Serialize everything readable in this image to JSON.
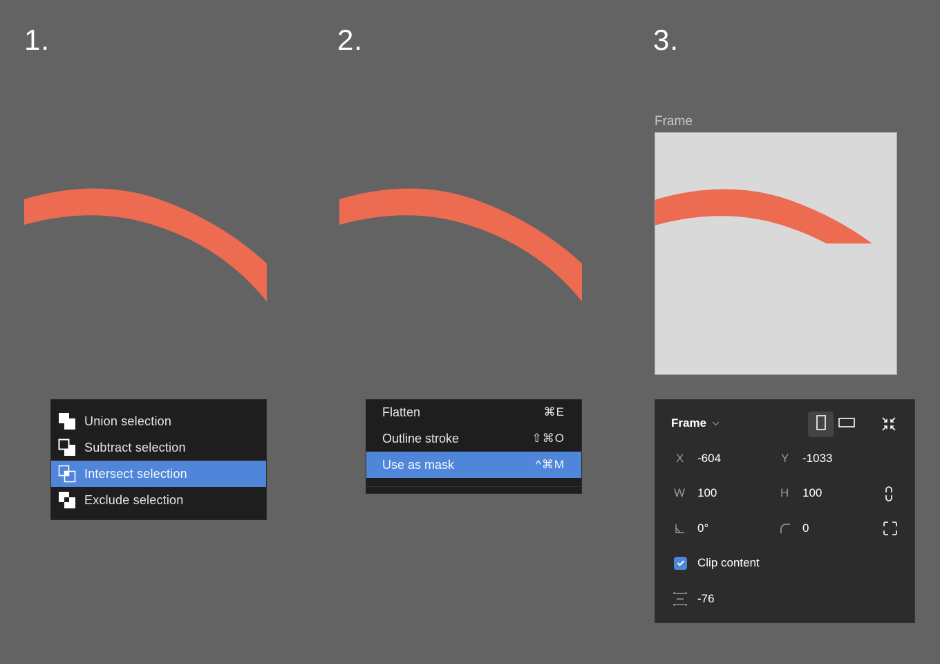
{
  "steps": [
    {
      "number": "1."
    },
    {
      "number": "2."
    },
    {
      "number": "3."
    }
  ],
  "colors": {
    "canvas_bg": "#636363",
    "arc": "#ec6b51",
    "menu_bg": "#1e1e1e",
    "highlight": "#4f86d9",
    "frame_fill": "#d9d9d9",
    "panel_bg": "#2c2c2c"
  },
  "boolean_menu": {
    "items": [
      {
        "label": "Union selection",
        "icon": "union-icon",
        "active": false
      },
      {
        "label": "Subtract selection",
        "icon": "subtract-icon",
        "active": false
      },
      {
        "label": "Intersect selection",
        "icon": "intersect-icon",
        "active": true
      },
      {
        "label": "Exclude selection",
        "icon": "exclude-icon",
        "active": false
      }
    ]
  },
  "context_menu": {
    "items": [
      {
        "label": "Flatten",
        "shortcut": "⌘E",
        "active": false
      },
      {
        "label": "Outline stroke",
        "shortcut": "⇧⌘O",
        "active": false
      },
      {
        "label": "Use as mask",
        "shortcut": "^⌘M",
        "active": true
      }
    ]
  },
  "frame": {
    "label": "Frame"
  },
  "properties": {
    "title": "Frame",
    "title_icon": "chevron-down-icon",
    "orientation": {
      "portrait_selected": true
    },
    "x": {
      "label": "X",
      "value": "-604"
    },
    "y": {
      "label": "Y",
      "value": "-1033"
    },
    "w": {
      "label": "W",
      "value": "100"
    },
    "h": {
      "label": "H",
      "value": "100"
    },
    "rotation": {
      "value": "0°"
    },
    "corner_radius": {
      "value": "0"
    },
    "clip_content": {
      "label": "Clip content",
      "checked": true
    },
    "spacing": {
      "value": "-76"
    }
  }
}
